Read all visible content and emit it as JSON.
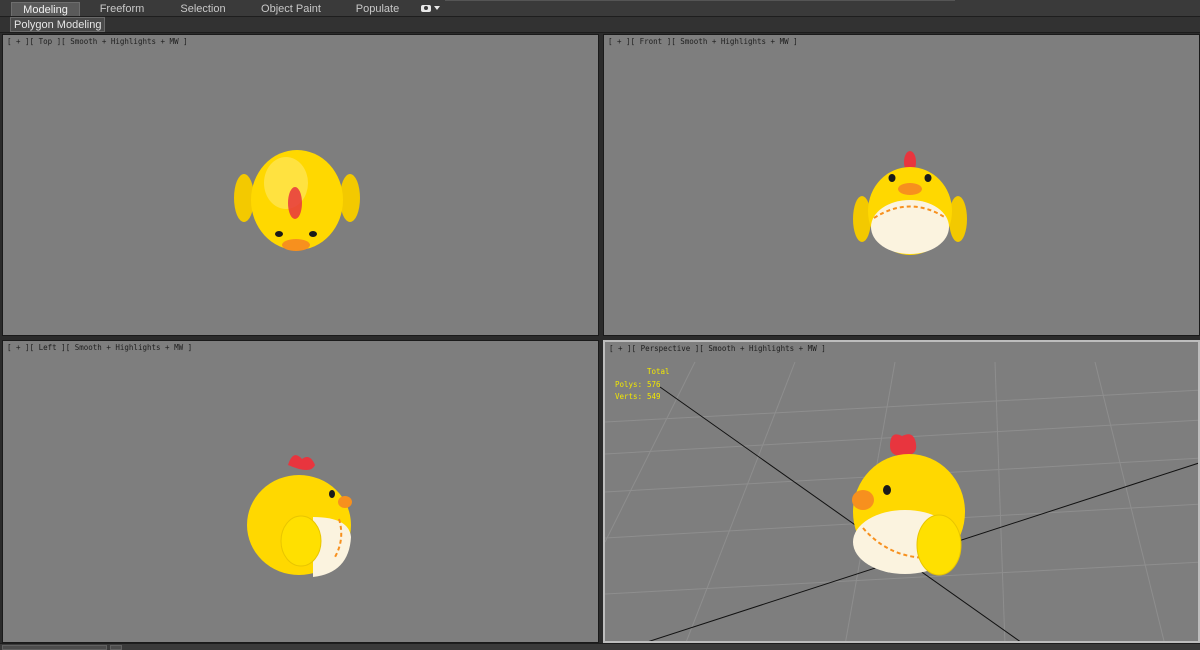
{
  "ribbon": {
    "tabs": [
      {
        "label": "Modeling",
        "active": true
      },
      {
        "label": "Freeform",
        "active": false
      },
      {
        "label": "Selection",
        "active": false
      },
      {
        "label": "Object Paint",
        "active": false
      },
      {
        "label": "Populate",
        "active": false
      }
    ],
    "extra_icon": "camera-dropdown-icon"
  },
  "subbar": {
    "title": "Polygon Modeling"
  },
  "viewports": {
    "top": {
      "label": "[ + ][ Top ][ Smooth + Highlights + MW ]"
    },
    "front": {
      "label": "[ + ][ Front ][ Smooth + Highlights + MW ]"
    },
    "left": {
      "label": "[ + ][ Left ][ Smooth + Highlights + MW ]"
    },
    "perspective": {
      "label": "[ + ][ Perspective ][ Smooth + Highlights + MW ]"
    }
  },
  "stats": {
    "header": "Total",
    "polys_label": "Polys:",
    "polys_value": "576",
    "verts_label": "Verts:",
    "verts_value": "549"
  },
  "colors": {
    "viewport_bg": "#7e7e7e",
    "chick_yellow": "#ffd800",
    "comb_red": "#e8353e",
    "beak_orange": "#f7901e",
    "belly_cream": "#fbf3df",
    "stats_yellow": "#f2e800"
  }
}
